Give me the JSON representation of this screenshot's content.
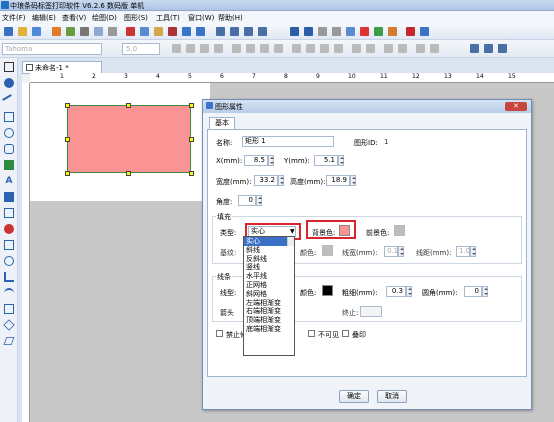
{
  "window": {
    "title": "中琅条码标签打印软件 V6.2.6 数码版 单机"
  },
  "menu": [
    "文件(F)",
    "编辑(E)",
    "查看(V)",
    "绘图(D)",
    "图形(S)",
    "工具(T)",
    "窗口(W)",
    "帮助(H)"
  ],
  "format_bar": {
    "font": "Tahoma",
    "size": "5.0"
  },
  "doc_tab": "未命名-1 *",
  "ruler_marks": [
    "1",
    "2",
    "3",
    "4",
    "5",
    "6",
    "7",
    "8",
    "9",
    "10",
    "11",
    "12",
    "13",
    "14",
    "15"
  ],
  "dialog": {
    "title": "图形属性",
    "tab": "基本",
    "name_label": "名称:",
    "name_value": "矩形 1",
    "id_label": "图形ID:",
    "id_value": "1",
    "x_label": "X(mm):",
    "x_value": "8.5",
    "y_label": "Y(mm):",
    "y_value": "5.1",
    "width_label": "宽度(mm):",
    "width_value": "33.2",
    "height_label": "高度(mm):",
    "height_value": "18.9",
    "angle_label": "角度:",
    "angle_value": "0",
    "fill_group": "填充",
    "type_label": "类型:",
    "type_value": "实心",
    "bgcolor_label": "背景色:",
    "fgcolor_label": "前景色:",
    "base_label": "基纹:",
    "base_color_label": "颜色:",
    "line_width_label": "线宽(mm):",
    "line_width_value": "0.1",
    "line_gap_label": "线距(mm):",
    "line_gap_value": "1.0",
    "line_group": "线条",
    "line_type_label": "线型:",
    "line_color_label": "颜色:",
    "thickness_label": "粗细(mm):",
    "thickness_value": "0.3",
    "corner_label": "圆角(mm):",
    "corner_value": "0",
    "arrow_label": "箭头",
    "end_label": "终止:",
    "disable_label": "禁止修",
    "invisible_label": "不可见",
    "print_label": "叠印",
    "ok": "确定",
    "cancel": "取消"
  },
  "fill_options": [
    "实心",
    "斜线",
    "反斜线",
    "竖线",
    "水平线",
    "正网格",
    "斜网格",
    "左端相渐变",
    "右端相渐变",
    "顶端相渐变",
    "底端相渐变"
  ],
  "colors": {
    "bg_fill": "#f99394",
    "fg_color": "#bdbdbd",
    "line_color": "#000000",
    "accent": "#3a71c6",
    "highlight": "#d9232e"
  }
}
